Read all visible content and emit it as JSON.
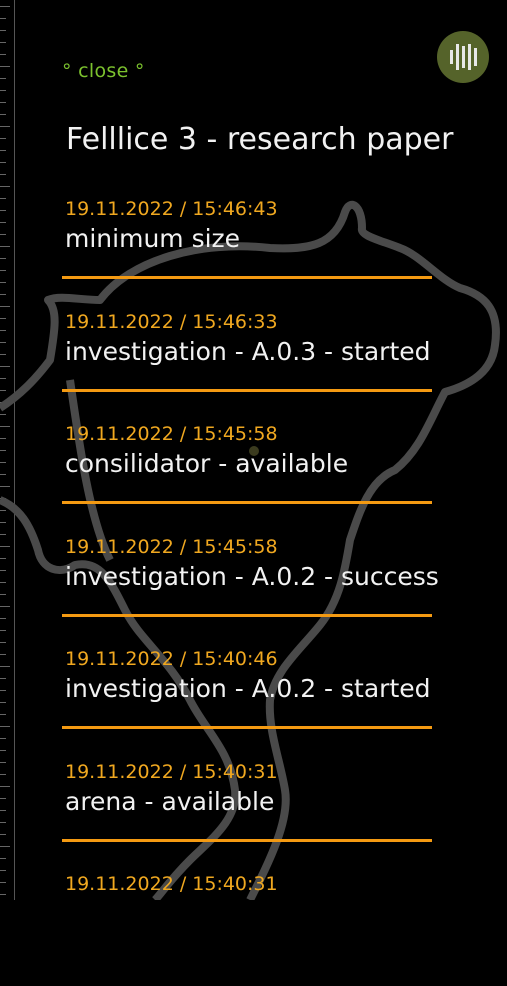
{
  "header": {
    "close_label": "° close °",
    "title": "Felllice 3 - research paper"
  },
  "icons": {
    "menu": "vertical-bars-icon"
  },
  "colors": {
    "background": "#000000",
    "close": "#7cc22e",
    "timestamp": "#f0a820",
    "divider": "#f49a12",
    "text": "#f2f2f2",
    "menu_button": "#55632a"
  },
  "log": [
    {
      "time": "19.11.2022 / 15:46:43",
      "message": "minimum size"
    },
    {
      "time": "19.11.2022 / 15:46:33",
      "message": "investigation - A.0.3 - started"
    },
    {
      "time": "19.11.2022 / 15:45:58",
      "message": "consilidator - available"
    },
    {
      "time": "19.11.2022 / 15:45:58",
      "message": "investigation - A.0.2 - success"
    },
    {
      "time": "19.11.2022 / 15:40:46",
      "message": "investigation - A.0.2 - started"
    },
    {
      "time": "19.11.2022 / 15:40:31",
      "message": "arena - available"
    },
    {
      "time": "19.11.2022 / 15:40:31",
      "message": ""
    }
  ]
}
